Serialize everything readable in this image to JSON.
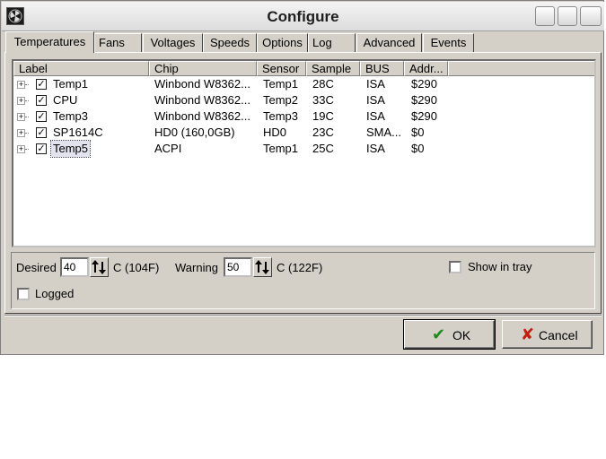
{
  "window": {
    "title": "Configure"
  },
  "tabs": [
    "Temperatures",
    "Fans",
    "Voltages",
    "Speeds",
    "Options",
    "Log",
    "Advanced",
    "Events"
  ],
  "active_tab": "Temperatures",
  "list": {
    "columns": [
      "Label",
      "Chip",
      "Sensor",
      "Sample",
      "BUS",
      "Addr..."
    ],
    "rows": [
      {
        "label": "Temp1",
        "chip": "Winbond W8362...",
        "sensor": "Temp1",
        "sample": "28C",
        "bus": "ISA",
        "addr": "$290",
        "checked": true
      },
      {
        "label": "CPU",
        "chip": "Winbond W8362...",
        "sensor": "Temp2",
        "sample": "33C",
        "bus": "ISA",
        "addr": "$290",
        "checked": true
      },
      {
        "label": "Temp3",
        "chip": "Winbond W8362...",
        "sensor": "Temp3",
        "sample": "19C",
        "bus": "ISA",
        "addr": "$290",
        "checked": true
      },
      {
        "label": "SP1614C",
        "chip": "HD0 (160,0GB)",
        "sensor": "HD0",
        "sample": "23C",
        "bus": "SMA...",
        "addr": "$0",
        "checked": true
      },
      {
        "label": "Temp5",
        "chip": "ACPI",
        "sensor": "Temp1",
        "sample": "25C",
        "bus": "ISA",
        "addr": "$0",
        "checked": true
      }
    ],
    "selected_row": "Temp5"
  },
  "settings": {
    "desired_label": "Desired",
    "desired_value": "40",
    "desired_unit": "C (104F)",
    "warning_label": "Warning",
    "warning_value": "50",
    "warning_unit": "C (122F)",
    "show_in_tray_label": "Show in tray",
    "show_in_tray_checked": false,
    "logged_label": "Logged",
    "logged_checked": false
  },
  "buttons": {
    "ok": "OK",
    "cancel": "Cancel"
  },
  "colors": {
    "ok_check": "#1a8a1a",
    "cancel_x": "#c02010"
  }
}
